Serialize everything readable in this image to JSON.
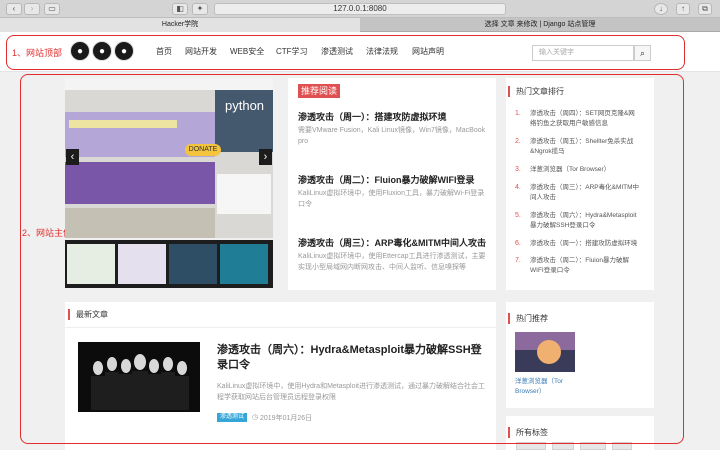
{
  "browser": {
    "url": "127.0.0.1:8080",
    "tabs": [
      {
        "label": "Hacker学院"
      },
      {
        "label": "选择 文章 来修改 | Django 站点管理"
      }
    ]
  },
  "annotations": {
    "header_label": "1、网站顶部",
    "main_label": "2、网站主体",
    "color": "#e02d2d"
  },
  "header": {
    "logos": [
      "github-icon",
      "github-icon",
      "github-icon"
    ],
    "nav": [
      {
        "label": "首页"
      },
      {
        "label": "网站开发"
      },
      {
        "label": "WEB安全"
      },
      {
        "label": "CTF学习"
      },
      {
        "label": "渗透测试"
      },
      {
        "label": "法律法规"
      },
      {
        "label": "网站声明"
      }
    ],
    "search_placeholder": "输入关键字",
    "search_icon": "search-icon"
  },
  "carousel": {
    "slide_texts": [
      "python",
      "DONATE"
    ],
    "prev_icon": "chevron-left-icon",
    "next_icon": "chevron-right-icon"
  },
  "recommended": {
    "label": "推荐阅读",
    "articles": [
      {
        "title": "渗透攻击（周一）：搭建攻防虚拟环境",
        "desc": "需要VMware Fusion，Kali Linux镜像，Win7镜像，MacBook pro"
      },
      {
        "title": "渗透攻击（周二）：Fluion暴力破解WIFI登录",
        "desc": "KaliLinux虚拟环境中，使用Fluxion工具，暴力破解Wi-Fi登录口令"
      },
      {
        "title": "渗透攻击（周三）：ARP毒化&MITM中间人攻击",
        "desc": "KaliLinux虚拟环境中，使用Ettercap工具进行渗透测试，主要实现小型局域网内断网攻击、中间人监听、信息嗅探等"
      }
    ]
  },
  "hot_articles": {
    "title": "热门文章排行",
    "items": [
      {
        "num": "1.",
        "label": "渗透攻击（周四）：SET网页克隆&网络钓鱼之获取用户敏感信息"
      },
      {
        "num": "2.",
        "label": "渗透攻击（周五）：Shellter免杀实战&Ngrok揽马"
      },
      {
        "num": "3.",
        "label": "洋葱浏览器（Tor Browser）"
      },
      {
        "num": "4.",
        "label": "渗透攻击（周三）：ARP毒化&MITM中间人攻击"
      },
      {
        "num": "5.",
        "label": "渗透攻击（周六）：Hydra&Metasploit暴力破解SSH登录口令"
      },
      {
        "num": "6.",
        "label": "渗透攻击（周一）：搭建攻防虚拟环境"
      },
      {
        "num": "7.",
        "label": "渗透攻击（周二）：Fluion暴力破解WIFI登录口令"
      }
    ]
  },
  "latest": {
    "title": "最新文章",
    "article": {
      "title": "渗透攻击（周六）：Hydra&Metasploit暴力破解SSH登录口令",
      "desc": "KaliLinux虚拟环境中，使用Hydra和Metasploit进行渗透测试，通过暴力破解结合社会工程学获取网站后台管理员远程登录权限",
      "category": "渗透测试",
      "date": "2019年01月26日",
      "clock_icon": "clock-icon"
    }
  },
  "hot_recommend": {
    "title": "热门推荐",
    "item": "洋葱浏览器（Tor Browser）"
  },
  "tags": {
    "title": "所有标签"
  }
}
